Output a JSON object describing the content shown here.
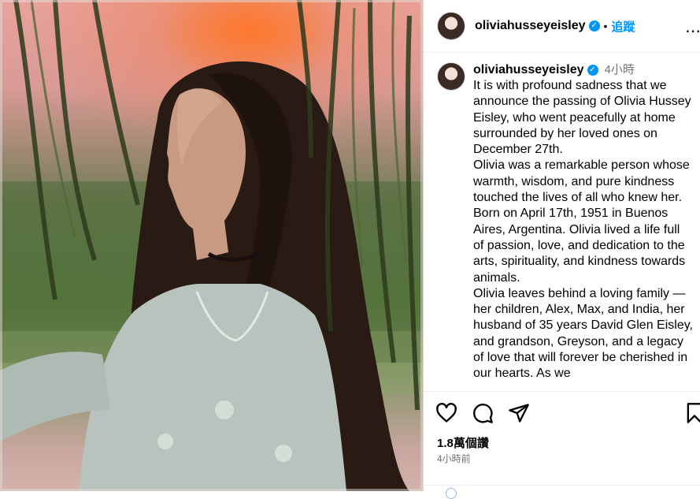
{
  "post": {
    "username": "oliviahusseyeisley",
    "follow_label": "追蹤",
    "separator": "•",
    "more_icon": "more-horizontal-icon",
    "verified_mark": "✓"
  },
  "caption": {
    "username": "oliviahusseyeisley",
    "time": "4小時",
    "text": "It is with profound sadness that we announce the passing of Olivia Hussey Eisley, who went peacefully at home surrounded by her loved ones on December 27th.\nOlivia was a remarkable person whose warmth, wisdom, and pure kindness touched the lives of all who knew her.\nBorn on April 17th, 1951 in Buenos Aires, Argentina. Olivia lived a life full of passion, love, and dedication to the arts, spirituality, and kindness towards animals.\nOlivia leaves behind a loving family — her children, Alex, Max, and India, her husband of 35 years David Glen Eisley, and grandson, Greyson, and a legacy of love that will forever be cherished in our hearts. As we"
  },
  "stats": {
    "views": "1.8萬個讚",
    "posted_ago": "4小時前"
  },
  "icons": {
    "like": "heart-icon",
    "comment": "comment-icon",
    "share": "send-icon",
    "save": "bookmark-icon"
  },
  "colors": {
    "link_blue": "#0095f6",
    "muted_text": "#737373",
    "border": "#efefef"
  }
}
